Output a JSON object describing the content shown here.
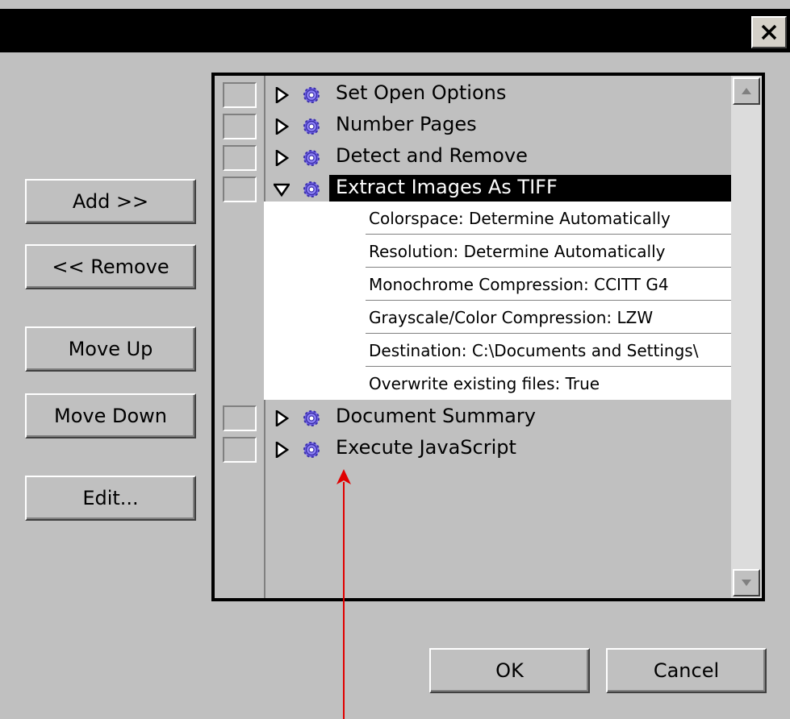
{
  "window": {
    "close_icon": "close-icon"
  },
  "buttons": {
    "add": "Add >>",
    "remove": "<< Remove",
    "move_up": "Move Up",
    "move_down": "Move Down",
    "edit": "Edit...",
    "ok": "OK",
    "cancel": "Cancel"
  },
  "sequence": {
    "items": [
      {
        "label": "Set Open Options",
        "expanded": false,
        "selected": false
      },
      {
        "label": "Number Pages",
        "expanded": false,
        "selected": false
      },
      {
        "label": "Detect and Remove",
        "expanded": false,
        "selected": false
      },
      {
        "label": "Extract Images As TIFF",
        "expanded": true,
        "selected": true
      },
      {
        "label": "Document Summary",
        "expanded": false,
        "selected": false
      },
      {
        "label": "Execute JavaScript",
        "expanded": false,
        "selected": false
      }
    ],
    "details": [
      "Colorspace: Determine Automatically",
      "Resolution: Determine Automatically",
      "Monochrome Compression: CCITT G4",
      "Grayscale/Color Compression: LZW",
      "Destination: C:\\Documents and Settings\\",
      "Overwrite existing files: True"
    ]
  },
  "colors": {
    "dialog_bg": "#c0c0c0",
    "titlebar": "#000000",
    "selection": "#000000",
    "gear": "#7b6cf0",
    "annotation_arrow": "#e00000"
  }
}
